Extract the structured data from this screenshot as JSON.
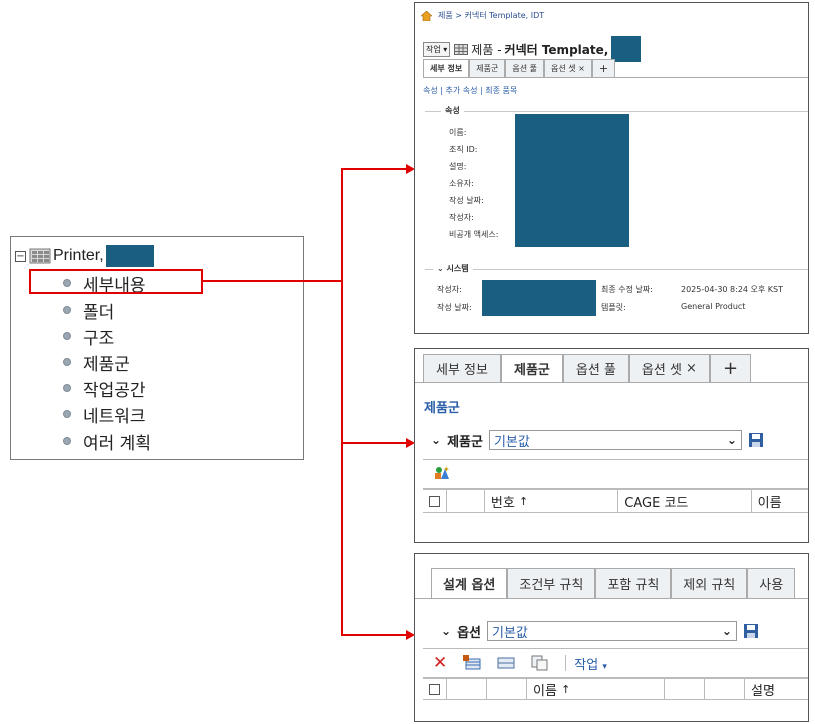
{
  "tree": {
    "root_label": "Printer,",
    "items": [
      "세부내용",
      "폴더",
      "구조",
      "제품군",
      "작업공간",
      "네트워크",
      "여러 계획"
    ]
  },
  "panel1": {
    "breadcrumb": "제품 > 커넥터 Template, IDT",
    "action_button": "작업",
    "title_prefix": "제품 -",
    "title_bold": "커넥터 Template,",
    "tabs": [
      "세부 정보",
      "제품군",
      "옵션 풀",
      "옵션 셋"
    ],
    "tab_close": "×",
    "tab_add": "+",
    "links": "속성 | 추가 속성 | 최종 품목",
    "attr_section": "속성",
    "attr_labels": [
      "이름:",
      "조직 ID:",
      "설명:",
      "소유자:",
      "작성 날짜:",
      "작성자:",
      "비공개 액세스:"
    ],
    "system_section": "시스템",
    "system": {
      "creator_label": "작성자:",
      "created_label": "작성 날짜:",
      "modified_label": "최종 수정 날짜:",
      "modified_value": "2025-04-30 8:24 오후 KST",
      "template_label": "템플릿:",
      "template_value": "General Product"
    }
  },
  "panel2": {
    "tabs": [
      "세부 정보",
      "제품군",
      "옵션 풀",
      "옵션 셋"
    ],
    "tab_close": "×",
    "tab_add": "+",
    "section_link": "제품군",
    "dropdown_label": "제품군",
    "dropdown_value": "기본값",
    "columns": [
      "번호",
      "CAGE 코드",
      "이름"
    ],
    "sort_indicator": "↑"
  },
  "panel3": {
    "tabs": [
      "설계 옵션",
      "조건부 규칙",
      "포함 규칙",
      "제외 규칙",
      "사용"
    ],
    "dropdown_label": "옵션",
    "dropdown_value": "기본값",
    "action_menu": "작업",
    "columns": [
      "이름",
      "설명"
    ],
    "sort_indicator": "↑"
  },
  "colors": {
    "accent_red": "#e00000",
    "redaction": "#1a5f82",
    "link_blue": "#2a5ea8"
  }
}
